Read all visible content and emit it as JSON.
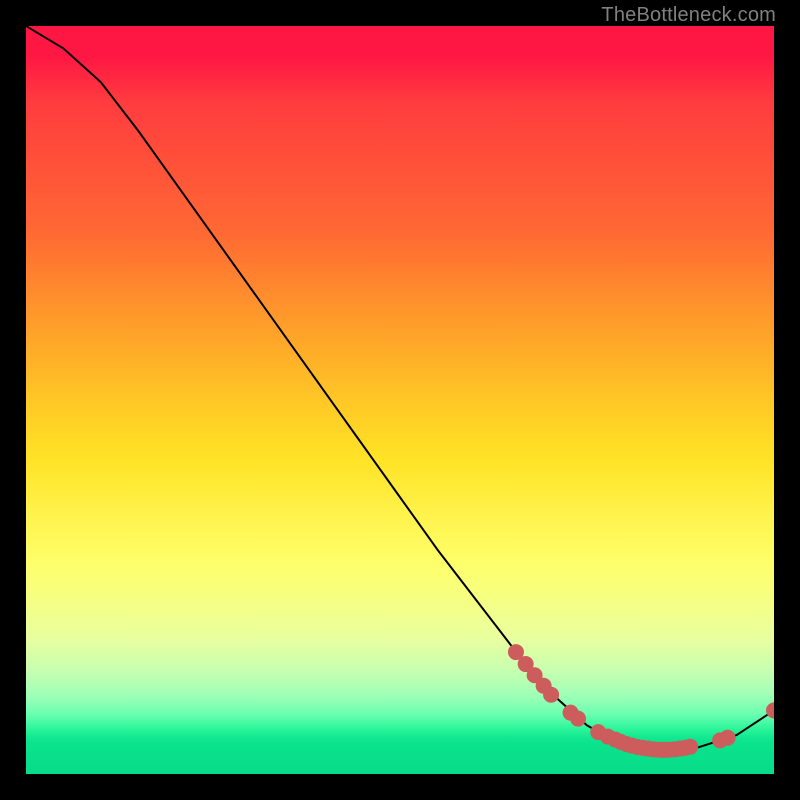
{
  "attribution": "TheBottleneck.com",
  "chart_data": {
    "type": "line",
    "title": "",
    "xlabel": "",
    "ylabel": "",
    "xlim": [
      0,
      100
    ],
    "ylim": [
      0,
      100
    ],
    "curve": [
      {
        "x": 0,
        "y": 100
      },
      {
        "x": 5,
        "y": 97
      },
      {
        "x": 10,
        "y": 92.5
      },
      {
        "x": 15,
        "y": 86
      },
      {
        "x": 20,
        "y": 79
      },
      {
        "x": 25,
        "y": 72
      },
      {
        "x": 30,
        "y": 65
      },
      {
        "x": 35,
        "y": 58
      },
      {
        "x": 40,
        "y": 51
      },
      {
        "x": 45,
        "y": 44
      },
      {
        "x": 50,
        "y": 37
      },
      {
        "x": 55,
        "y": 30
      },
      {
        "x": 60,
        "y": 23.5
      },
      {
        "x": 65,
        "y": 17
      },
      {
        "x": 70,
        "y": 11
      },
      {
        "x": 75,
        "y": 6.5
      },
      {
        "x": 80,
        "y": 3.7
      },
      {
        "x": 85,
        "y": 3.2
      },
      {
        "x": 90,
        "y": 3.6
      },
      {
        "x": 95,
        "y": 5.2
      },
      {
        "x": 100,
        "y": 8.5
      }
    ],
    "markers": [
      {
        "x": 65.5,
        "y": 16.3
      },
      {
        "x": 66.8,
        "y": 14.7
      },
      {
        "x": 68.0,
        "y": 13.2
      },
      {
        "x": 69.2,
        "y": 11.8
      },
      {
        "x": 70.2,
        "y": 10.6
      },
      {
        "x": 72.8,
        "y": 8.2
      },
      {
        "x": 73.8,
        "y": 7.4
      },
      {
        "x": 76.5,
        "y": 5.6
      },
      {
        "x": 77.8,
        "y": 5.0
      },
      {
        "x": 78.8,
        "y": 4.6
      },
      {
        "x": 79.5,
        "y": 4.3
      },
      {
        "x": 80.3,
        "y": 4.0
      },
      {
        "x": 81.0,
        "y": 3.8
      },
      {
        "x": 81.8,
        "y": 3.6
      },
      {
        "x": 82.5,
        "y": 3.5
      },
      {
        "x": 83.2,
        "y": 3.4
      },
      {
        "x": 83.9,
        "y": 3.3
      },
      {
        "x": 84.6,
        "y": 3.25
      },
      {
        "x": 85.3,
        "y": 3.22
      },
      {
        "x": 86.0,
        "y": 3.24
      },
      {
        "x": 86.7,
        "y": 3.3
      },
      {
        "x": 87.4,
        "y": 3.4
      },
      {
        "x": 88.1,
        "y": 3.5
      },
      {
        "x": 88.8,
        "y": 3.65
      },
      {
        "x": 92.8,
        "y": 4.5
      },
      {
        "x": 93.8,
        "y": 4.85
      },
      {
        "x": 100,
        "y": 8.5
      }
    ],
    "marker_color": "#cd5c5c",
    "marker_radius": 8,
    "line_color": "#000000",
    "line_width": 2
  }
}
